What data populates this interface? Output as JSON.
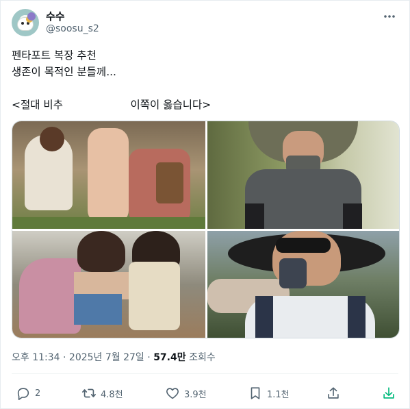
{
  "author": {
    "name": "수수",
    "handle": "@soosu_s2"
  },
  "tweet": {
    "lines": [
      "펜타포트 복장 추천",
      "생존이 목적인 분들께...",
      "",
      "<절대 비추                    이쪽이 옳습니다>"
    ]
  },
  "meta": {
    "time": "오후 11:34",
    "date": "2025년 7월 27일",
    "views": "57.4만",
    "views_label": "조회수",
    "separator": "·"
  },
  "actions": {
    "replies": "2",
    "retweets": "4.8천",
    "likes": "3.9천",
    "bookmarks": "1.1천"
  },
  "icons": [
    "more-icon",
    "reply-icon",
    "retweet-icon",
    "like-icon",
    "bookmark-icon",
    "share-icon",
    "download-icon"
  ],
  "colors": {
    "text": "#0f1419",
    "muted": "#536471",
    "download_accent": "#00ba7c"
  }
}
